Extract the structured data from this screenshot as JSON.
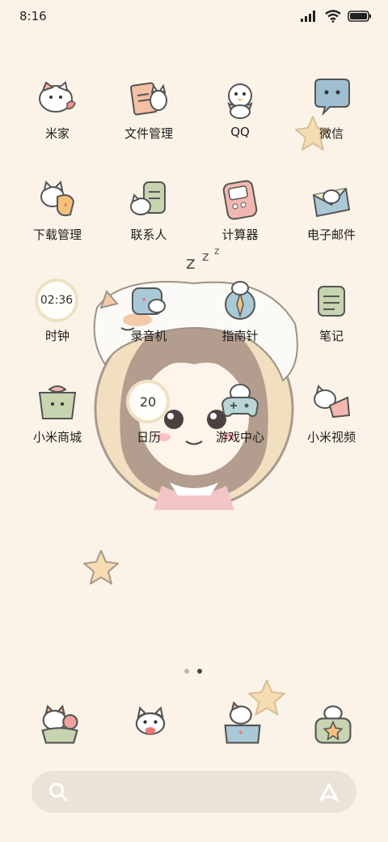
{
  "status_bar": {
    "time": "8:16",
    "icons": [
      "signal-icon",
      "wifi-icon",
      "battery-icon"
    ]
  },
  "apps": [
    {
      "label": "米家",
      "icon": "cat-heart-icon"
    },
    {
      "label": "文件管理",
      "icon": "cat-file-icon"
    },
    {
      "label": "QQ",
      "icon": "penguin-icon"
    },
    {
      "label": "微信",
      "icon": "chat-bubble-icon"
    },
    {
      "label": "下载管理",
      "icon": "cat-download-icon"
    },
    {
      "label": "联系人",
      "icon": "cat-contacts-icon"
    },
    {
      "label": "计算器",
      "icon": "cat-calculator-icon"
    },
    {
      "label": "电子邮件",
      "icon": "cat-mail-icon"
    },
    {
      "label": "时钟",
      "icon": "clock-icon",
      "widget_value": "02:36"
    },
    {
      "label": "录音机",
      "icon": "cat-recorder-icon"
    },
    {
      "label": "指南针",
      "icon": "cat-compass-icon"
    },
    {
      "label": "笔记",
      "icon": "cat-notes-icon"
    },
    {
      "label": "小米商城",
      "icon": "cat-shop-icon"
    },
    {
      "label": "日历",
      "icon": "calendar-icon",
      "widget_value": "20"
    },
    {
      "label": "游戏中心",
      "icon": "cat-gamepad-icon"
    },
    {
      "label": "小米视频",
      "icon": "cat-video-icon"
    }
  ],
  "page_indicator": {
    "count": 2,
    "active": 2
  },
  "dock": [
    "cat-phone-icon",
    "cat-message-icon",
    "cat-browser-icon",
    "cat-star-icon"
  ],
  "colors": {
    "background": "#fcf3e8",
    "search_bar": "#ebe3d7"
  }
}
